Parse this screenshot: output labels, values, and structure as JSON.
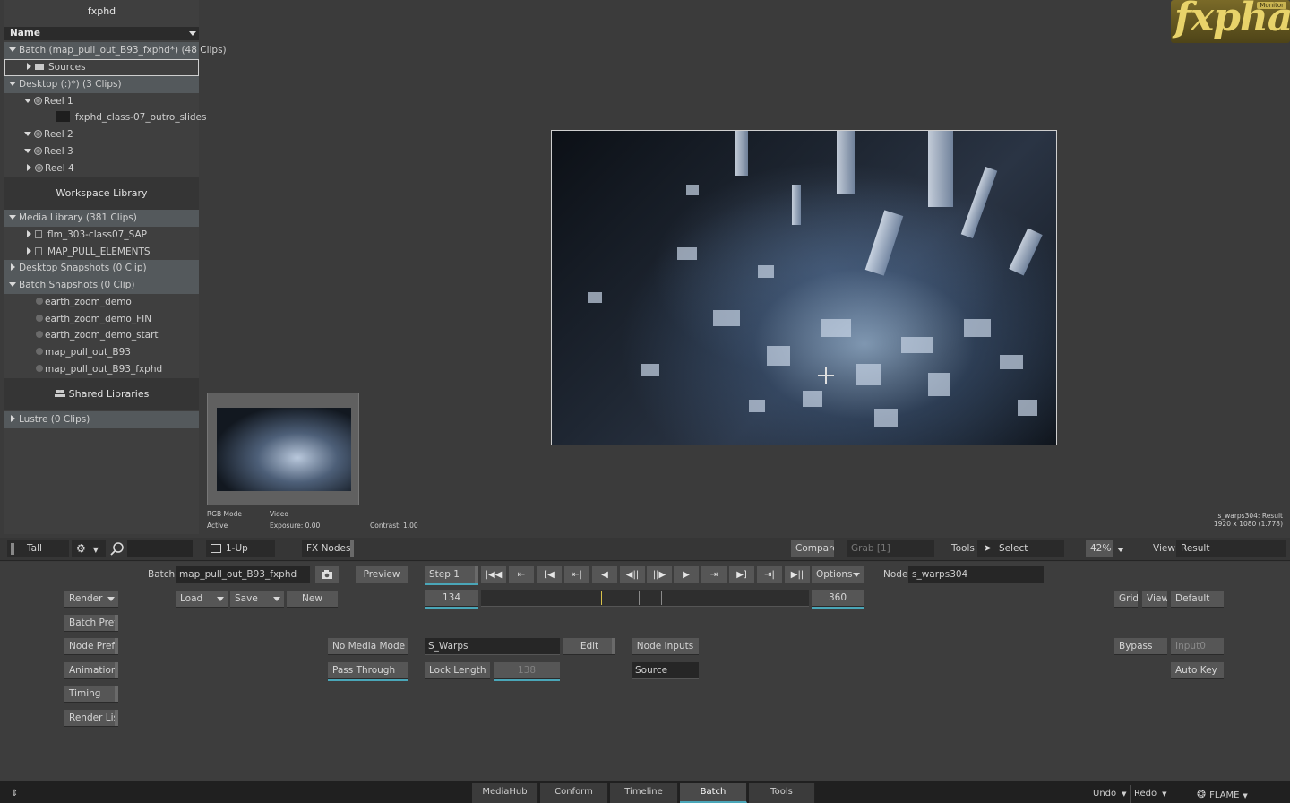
{
  "library": {
    "title": "fxphd",
    "column": "Name",
    "rows": [
      {
        "label": "Batch (map_pull_out_B93_fxphd*) (48 Clips)",
        "indent": 0
      },
      {
        "label": "Sources",
        "indent": 1
      },
      {
        "label": "Desktop (:)*) (3 Clips)",
        "indent": 0
      },
      {
        "label": "Reel 1",
        "indent": 1
      },
      {
        "label": "fxphd_class-07_outro_slides",
        "indent": 2
      },
      {
        "label": "Reel 2",
        "indent": 1
      },
      {
        "label": "Reel 3",
        "indent": 1
      },
      {
        "label": "Reel 4",
        "indent": 1
      }
    ],
    "workspace_library": "Workspace Library",
    "media_rows": [
      {
        "label": "Media Library (381 Clips)"
      },
      {
        "label": "flm_303-class07_SAP"
      },
      {
        "label": "MAP_PULL_ELEMENTS"
      },
      {
        "label": "Desktop Snapshots (0 Clip)"
      },
      {
        "label": "Batch Snapshots (0 Clip)"
      },
      {
        "label": "earth_zoom_demo"
      },
      {
        "label": "earth_zoom_demo_FIN"
      },
      {
        "label": "earth_zoom_demo_start"
      },
      {
        "label": "map_pull_out_B93"
      },
      {
        "label": "map_pull_out_B93_fxphd"
      }
    ],
    "shared_libraries": "Shared Libraries",
    "lustre": "Lustre (0 Clips)"
  },
  "thumbnail": {
    "rgb_mode": "RGB Mode",
    "active": "Active",
    "video": "Video",
    "exposure": "Exposure: 0.00",
    "contrast": "Contrast: 1.00"
  },
  "viewer_info": {
    "line1": "s_warps304: Result",
    "line2": "1920 x 1080 (1.778)"
  },
  "logo": {
    "text": "fxpha",
    "badge": "Monitor"
  },
  "toolbar1": {
    "tall": "Tall",
    "one_up": "1-Up",
    "fx_nodes": "FX Nodes",
    "compare": "Compare",
    "grab": "Grab [1]",
    "tools_label": "Tools",
    "select": "Select",
    "zoom": "42%",
    "view_label": "View",
    "view_value": "Result"
  },
  "batch": {
    "batch_label": "Batch",
    "batch_name": "map_pull_out_B93_fxphd",
    "preview": "Preview",
    "step": "Step 1",
    "options": "Options",
    "node_label": "Node",
    "node_name": "s_warps304",
    "render": "Render",
    "load": "Load",
    "save": "Save",
    "new": "New",
    "frame_start": "134",
    "frame_end": "360",
    "grid": "Grid",
    "view": "View",
    "default": "Default",
    "batch_prefs": "Batch Prefs",
    "node_prefs": "Node Prefs",
    "animation": "Animation",
    "timing": "Timing",
    "render_list": "Render List",
    "no_media_mode": "No Media Mode",
    "pass_through": "Pass Through",
    "s_warps": "S_Warps",
    "edit": "Edit",
    "lock_length": "Lock Length",
    "length_value": "138",
    "node_inputs": "Node Inputs",
    "source": "Source",
    "bypass": "Bypass",
    "input0": "Input0",
    "auto_key": "Auto Key"
  },
  "transport": [
    "|◀◀",
    "⇤",
    "[◀",
    "⇤|",
    "◀",
    "◀||",
    "||▶",
    "▶",
    "⇥",
    "▶]",
    "⇥|",
    "▶||"
  ],
  "status": {
    "tabs": [
      "MediaHub",
      "Conform",
      "Timeline",
      "Batch",
      "Tools"
    ],
    "active_tab": "Batch",
    "undo": "Undo",
    "redo": "Redo",
    "flame": "FLAME"
  },
  "colors": {
    "accent": "#4aa6b8",
    "marker": "#d8c24a",
    "logo": "#e8d36a"
  }
}
